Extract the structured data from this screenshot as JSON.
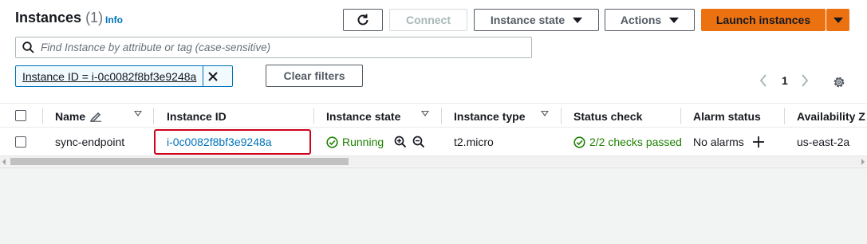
{
  "header": {
    "title": "Instances",
    "count": "(1)",
    "info_label": "Info"
  },
  "toolbar": {
    "connect_label": "Connect",
    "instance_state_label": "Instance state",
    "actions_label": "Actions",
    "launch_label": "Launch instances"
  },
  "search": {
    "placeholder": "Find Instance by attribute or tag (case-sensitive)"
  },
  "filter": {
    "token": "Instance ID = i-0c0082f8bf3e9248a",
    "clear_label": "Clear filters"
  },
  "pagination": {
    "current_page": "1"
  },
  "table": {
    "columns": [
      "Name",
      "Instance ID",
      "Instance state",
      "Instance type",
      "Status check",
      "Alarm status",
      "Availability Z"
    ],
    "rows": [
      {
        "name": "sync-endpoint",
        "instance_id": "i-0c0082f8bf3e9248a",
        "state": "Running",
        "type": "t2.micro",
        "status_check": "2/2 checks passed",
        "alarm_status": "No alarms",
        "availability_zone": "us-east-2a"
      }
    ]
  },
  "colors": {
    "accent": "#0073bb",
    "primary_button": "#ec7211",
    "success": "#1d8102",
    "highlight": "#d0021b"
  }
}
